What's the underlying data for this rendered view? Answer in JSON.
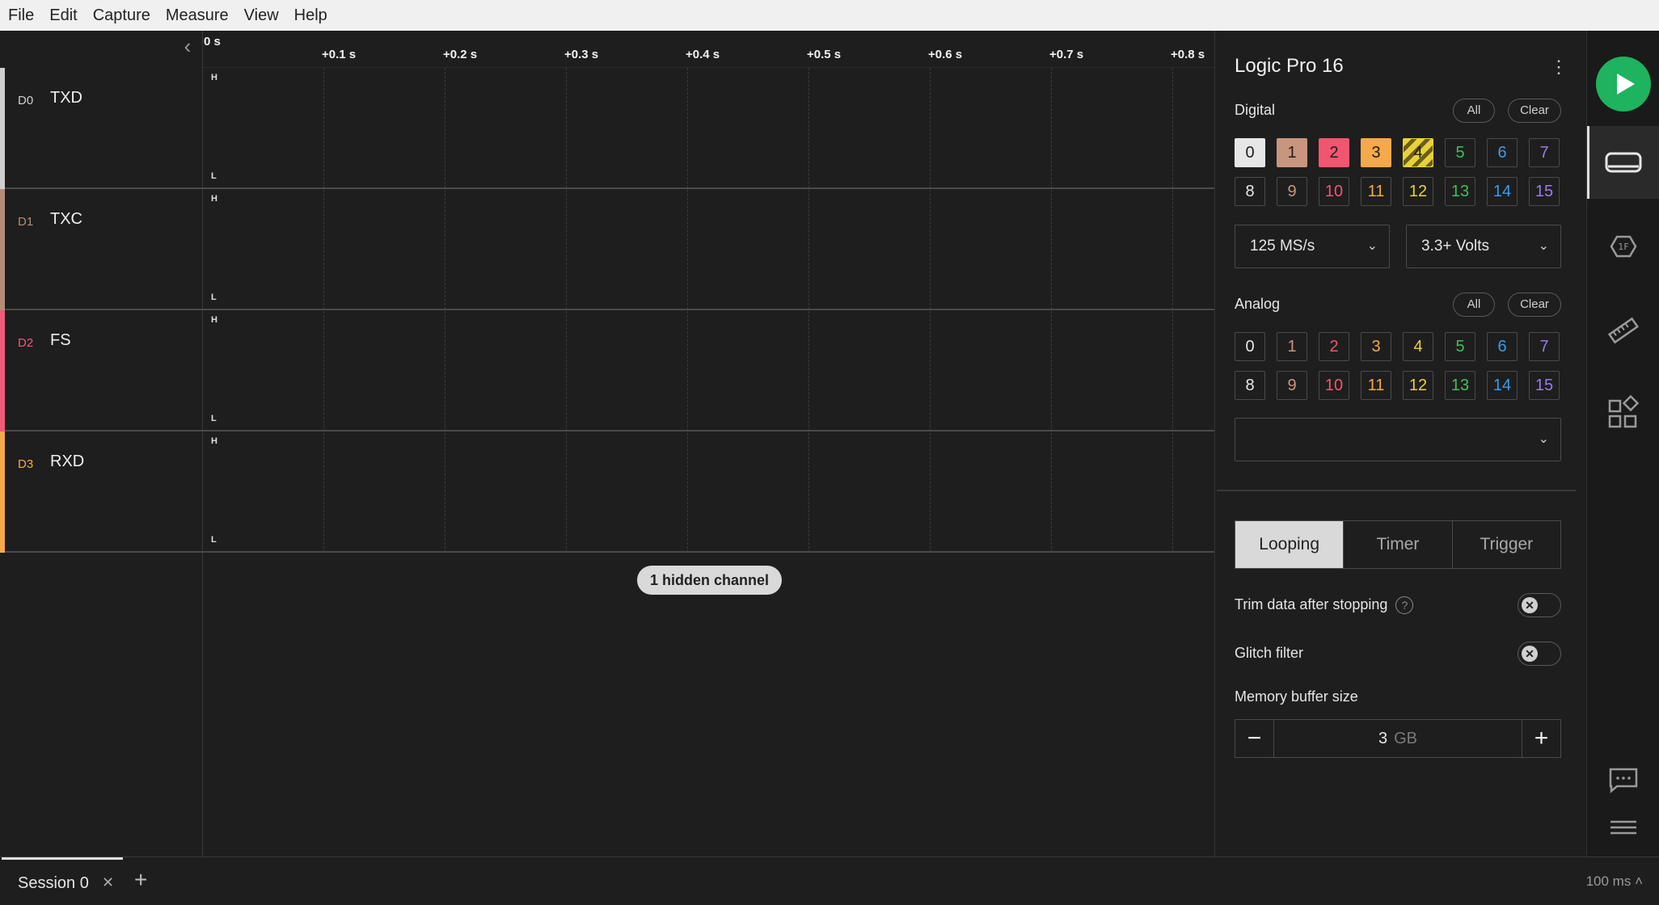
{
  "menu": [
    "File",
    "Edit",
    "Capture",
    "Measure",
    "View",
    "Help"
  ],
  "ruler": {
    "ticks": [
      "0 s",
      "+0.1 s",
      "+0.2 s",
      "+0.3 s",
      "+0.4 s",
      "+0.5 s",
      "+0.6 s",
      "+0.7 s",
      "+0.8 s"
    ]
  },
  "channels": [
    {
      "id": "D0",
      "name": "TXD",
      "color": "#cfcfcf",
      "high": "H",
      "low": "L"
    },
    {
      "id": "D1",
      "name": "TXC",
      "color": "#b58c7a",
      "high": "H",
      "low": "L"
    },
    {
      "id": "D2",
      "name": "FS",
      "color": "#f05a78",
      "high": "H",
      "low": "L"
    },
    {
      "id": "D3",
      "name": "RXD",
      "color": "#f5a94a",
      "high": "H",
      "low": "L"
    }
  ],
  "hidden_channels_label": "1 hidden channel",
  "panel": {
    "device_title": "Logic Pro 16",
    "digital": {
      "label": "Digital",
      "all_label": "All",
      "clear_label": "Clear",
      "channels": [
        "0",
        "1",
        "2",
        "3",
        "4",
        "5",
        "6",
        "7",
        "8",
        "9",
        "10",
        "11",
        "12",
        "13",
        "14",
        "15"
      ],
      "enabled": [
        0,
        1,
        2,
        3,
        4
      ]
    },
    "sample_rate": "125 MS/s",
    "voltage": "3.3+ Volts",
    "analog": {
      "label": "Analog",
      "all_label": "All",
      "clear_label": "Clear",
      "channels": [
        "0",
        "1",
        "2",
        "3",
        "4",
        "5",
        "6",
        "7",
        "8",
        "9",
        "10",
        "11",
        "12",
        "13",
        "14",
        "15"
      ],
      "select_value": ""
    },
    "channel_colors": [
      "#e6e6e6",
      "#c9957f",
      "#f0566f",
      "#f5a94a",
      "#e8d23a",
      "#3fbf5a",
      "#3d9be9",
      "#9a7be8",
      "#e6e6e6",
      "#c9957f",
      "#f0566f",
      "#f5a94a",
      "#e8d23a",
      "#3fbf5a",
      "#3d9be9",
      "#9a7be8"
    ],
    "tabs": [
      "Looping",
      "Timer",
      "Trigger"
    ],
    "active_tab": "Looping",
    "trim_label": "Trim data after stopping",
    "glitch_label": "Glitch filter",
    "memory_label": "Memory buffer size",
    "memory_value": "3",
    "memory_unit": "GB"
  },
  "bottom": {
    "session_name": "Session 0",
    "timescale": "100 ms"
  }
}
